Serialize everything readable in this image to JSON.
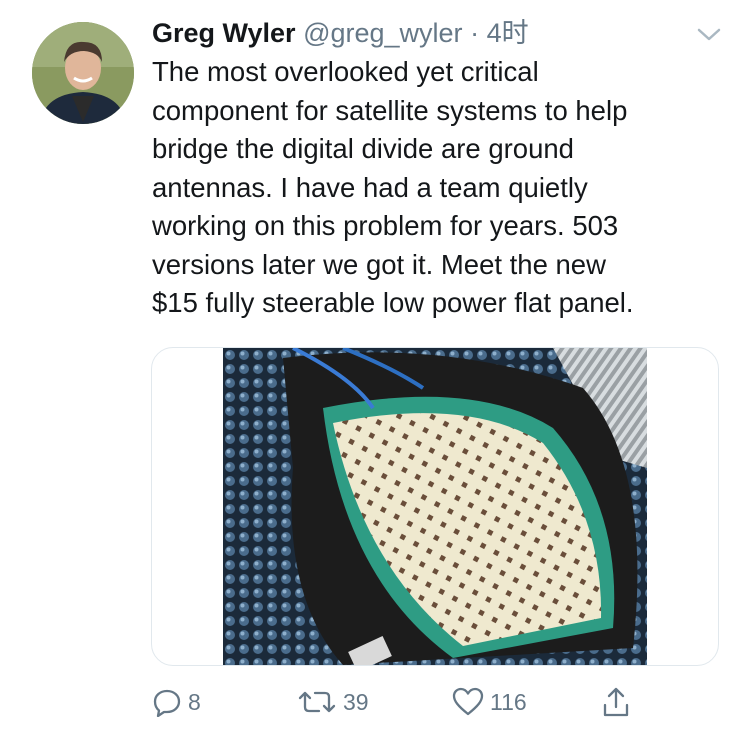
{
  "tweet": {
    "author_name": "Greg Wyler",
    "handle": "@greg_wyler",
    "separator": "·",
    "time": "4时",
    "text": "The most overlooked yet critical\ncomponent for satellite systems to help\nbridge the digital divide are ground\nantennas. I have had a team quietly\nworking on this problem for years. 503\nversions later we got it. Meet the new\n$15 fully steerable low power flat panel."
  },
  "actions": {
    "reply_count": "8",
    "retweet_count": "39",
    "like_count": "116"
  },
  "icons": {
    "menu": "chevron-down-icon",
    "reply": "reply-icon",
    "retweet": "retweet-icon",
    "like": "heart-icon",
    "share": "share-icon"
  },
  "colors": {
    "text": "#14171a",
    "secondary": "#657786",
    "border": "#e1e8ed"
  }
}
